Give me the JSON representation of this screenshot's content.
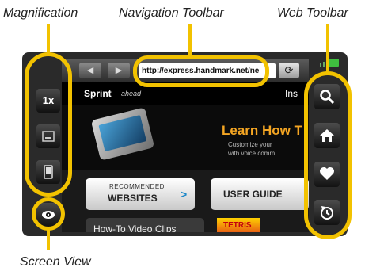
{
  "callouts": {
    "magnification": "Magnification",
    "navigation_toolbar": "Navigation Toolbar",
    "web_toolbar": "Web Toolbar",
    "screen_view": "Screen View"
  },
  "magnification_toolbar": {
    "zoom_label": "1x"
  },
  "navigation_toolbar": {
    "back_glyph": "◀",
    "forward_glyph": "▶",
    "url": "http://express.handmark.net/ne",
    "refresh_glyph": "⟳"
  },
  "web_toolbar": {
    "icons": [
      "search-icon",
      "home-icon",
      "favorites-heart-icon",
      "history-icon"
    ]
  },
  "page": {
    "brand": "Sprint",
    "brand_tagline": "ahead",
    "header_right": "Ins",
    "promo_title": "Learn How T",
    "promo_sub1": "Customize your",
    "promo_sub2": "with voice comm",
    "recommended_line1": "RECOMMENDED",
    "recommended_line2": "WEBSITES",
    "recommended_chevron": ">",
    "user_guide": "USER GUIDE",
    "howto": "How-To Video Clips",
    "thumb_text": "TETRIS"
  },
  "colors": {
    "highlight": "#f2c200",
    "device_body": "#2a2a2a",
    "promo_accent": "#f5a623",
    "link_accent": "#1e88c8"
  }
}
